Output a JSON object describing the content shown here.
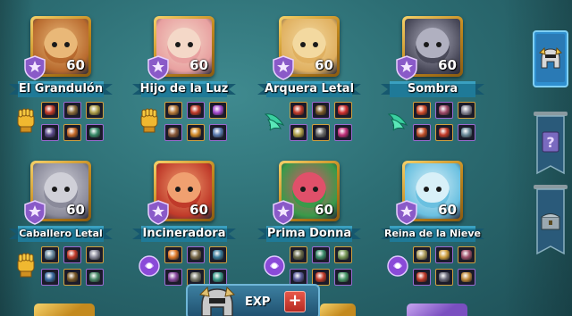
{
  "heroes": [
    {
      "name": "El Grandulón",
      "level": "60",
      "class": "fist",
      "palette": [
        "#b86a2e",
        "#e9b878"
      ],
      "gear": [
        "#c23b2a",
        "#8a6b3a",
        "#b0a04a",
        "#5a4a8a",
        "#c56a2a",
        "#3a8a6a"
      ]
    },
    {
      "name": "Hijo de la Luz",
      "level": "60",
      "class": "fist",
      "palette": [
        "#e8a0a0",
        "#f4d8c8"
      ],
      "gear": [
        "#b77a3a",
        "#c23b2a",
        "#a54ad0",
        "#8a5a3a",
        "#d28a2a",
        "#5a7ab0"
      ]
    },
    {
      "name": "Arquera Letal",
      "level": "60",
      "class": "wing",
      "palette": [
        "#e0b060",
        "#f3d9a0"
      ],
      "gear": [
        "#c23b2a",
        "#7a5a2a",
        "#d03030",
        "#b0a04a",
        "#6a6a6a",
        "#c0307a"
      ]
    },
    {
      "name": "Sombra",
      "level": "60",
      "class": "wing",
      "palette": [
        "#4a4a5a",
        "#b0b0c0"
      ],
      "gear": [
        "#d04a2a",
        "#a04a6a",
        "#8a8a9a",
        "#c2502a",
        "#c23b2a",
        "#6a8a9a"
      ]
    },
    {
      "name": "Caballero Letal",
      "level": "60",
      "class": "fist",
      "palette": [
        "#8a8a9a",
        "#d0d0d8"
      ],
      "gear": [
        "#6a8aa0",
        "#c23b2a",
        "#8a8a9a",
        "#3a6aa0",
        "#7a5a2a",
        "#4a8a6a"
      ]
    },
    {
      "name": "Incineradora",
      "level": "60",
      "class": "orb",
      "palette": [
        "#c03a2a",
        "#f0a070"
      ],
      "gear": [
        "#e07a2a",
        "#7a6a4a",
        "#3a7a9a",
        "#8a4aa0",
        "#7a7a6a",
        "#3a9a8a"
      ]
    },
    {
      "name": "Prima Donna",
      "level": "60",
      "class": "orb",
      "palette": [
        "#3a9a4a",
        "#e0506a"
      ],
      "gear": [
        "#6a6a4a",
        "#3a8a6a",
        "#7a9a5a",
        "#5a5a9a",
        "#c23b2a",
        "#4a9a6a"
      ]
    },
    {
      "name": "Reina de la Nieve",
      "level": "60",
      "class": "orb",
      "palette": [
        "#6ac0e0",
        "#d8f0f8"
      ],
      "gear": [
        "#b0a060",
        "#d0a040",
        "#a0506a",
        "#c23b2a",
        "#6a6a7a",
        "#c08a3a"
      ]
    }
  ],
  "exp_bar": {
    "label": "EXP",
    "plus": "+"
  },
  "side_tabs": [
    "helmet-icon",
    "scroll-question-icon",
    "chest-icon"
  ],
  "colors": {
    "gold": "#e2b43a",
    "banner": "#1f6f8f",
    "purple": "#7a4fc0"
  }
}
